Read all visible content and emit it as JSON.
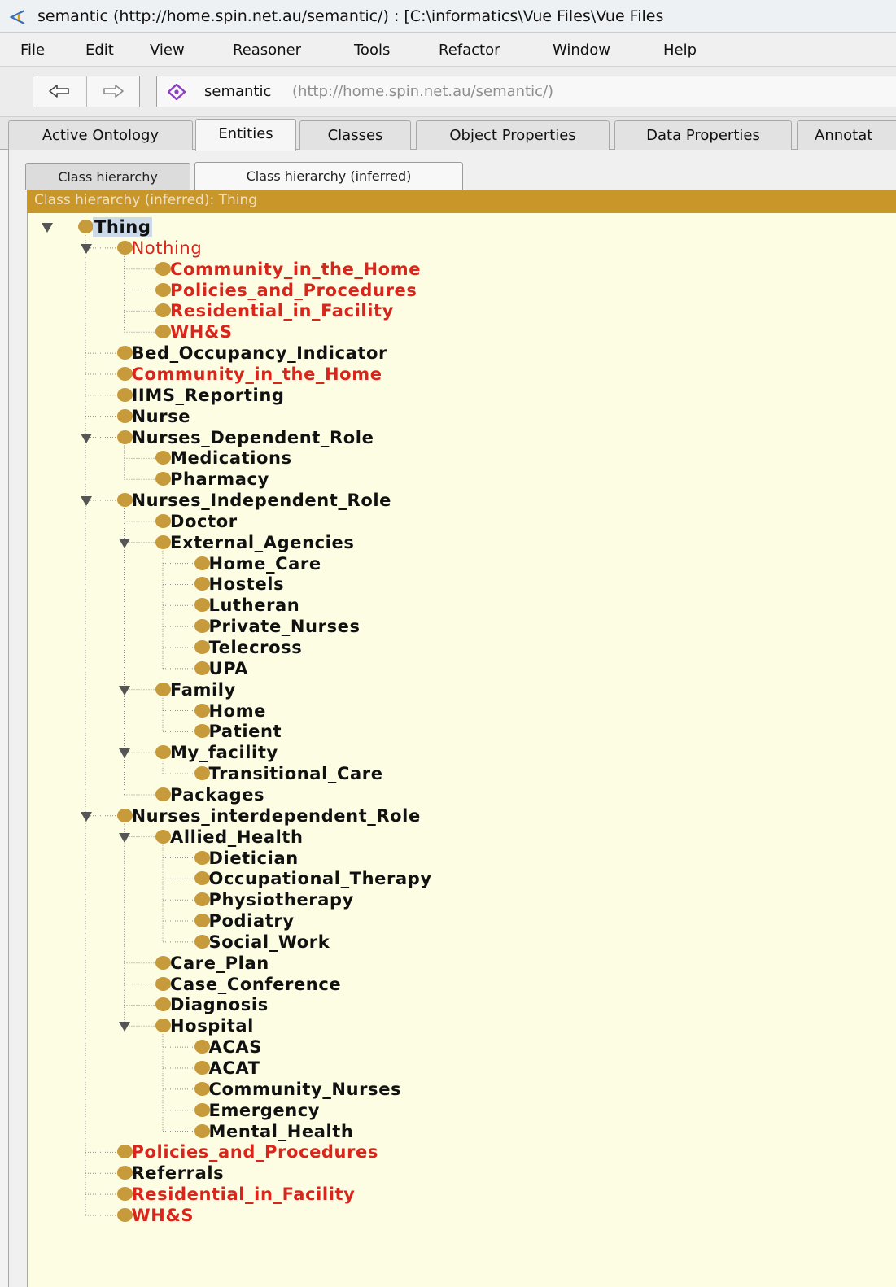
{
  "window": {
    "title": "semantic (http://home.spin.net.au/semantic/)  : [C:\\informatics\\Vue Files\\Vue Files"
  },
  "menu": [
    "File",
    "Edit",
    "View",
    "Reasoner",
    "Tools",
    "Refactor",
    "Window",
    "Help"
  ],
  "toolbar": {
    "ontology_name": "semantic",
    "ontology_iri": "(http://home.spin.net.au/semantic/)"
  },
  "tabs": [
    {
      "label": "Active Ontology",
      "active": false
    },
    {
      "label": "Entities",
      "active": true
    },
    {
      "label": "Classes",
      "active": false
    },
    {
      "label": "Object Properties",
      "active": false
    },
    {
      "label": "Data Properties",
      "active": false
    },
    {
      "label": "Annotat",
      "active": false
    }
  ],
  "subtabs": [
    {
      "label": "Class hierarchy",
      "active": false
    },
    {
      "label": "Class hierarchy (inferred)",
      "active": true
    }
  ],
  "view_header": "Class hierarchy (inferred): Thing",
  "colors": {
    "header_bar": "#c9962a",
    "tree_background": "#fdfde3",
    "class_bullet": "#c79a3c",
    "unsatisfiable_text": "#d8261c"
  },
  "tree": [
    {
      "label": "Thing",
      "depth": 0,
      "expanded": true,
      "selected": true
    },
    {
      "label": "Nothing",
      "depth": 1,
      "expanded": true,
      "red": true,
      "light": true
    },
    {
      "label": "Community_in_the_Home",
      "depth": 2,
      "red": true
    },
    {
      "label": "Policies_and_Procedures",
      "depth": 2,
      "red": true
    },
    {
      "label": "Residential_in_Facility",
      "depth": 2,
      "red": true
    },
    {
      "label": "WH&S",
      "depth": 2,
      "red": true
    },
    {
      "label": "Bed_Occupancy_Indicator",
      "depth": 1
    },
    {
      "label": "Community_in_the_Home",
      "depth": 1,
      "red": true
    },
    {
      "label": "IIMS_Reporting",
      "depth": 1
    },
    {
      "label": "Nurse",
      "depth": 1
    },
    {
      "label": "Nurses_Dependent_Role",
      "depth": 1,
      "expanded": true
    },
    {
      "label": "Medications",
      "depth": 2
    },
    {
      "label": "Pharmacy",
      "depth": 2
    },
    {
      "label": "Nurses_Independent_Role",
      "depth": 1,
      "expanded": true
    },
    {
      "label": "Doctor",
      "depth": 2
    },
    {
      "label": "External_Agencies",
      "depth": 2,
      "expanded": true
    },
    {
      "label": "Home_Care",
      "depth": 3
    },
    {
      "label": "Hostels",
      "depth": 3
    },
    {
      "label": "Lutheran",
      "depth": 3
    },
    {
      "label": "Private_Nurses",
      "depth": 3
    },
    {
      "label": "Telecross",
      "depth": 3
    },
    {
      "label": "UPA",
      "depth": 3
    },
    {
      "label": "Family",
      "depth": 2,
      "expanded": true
    },
    {
      "label": "Home",
      "depth": 3
    },
    {
      "label": "Patient",
      "depth": 3
    },
    {
      "label": "My_facility",
      "depth": 2,
      "expanded": true
    },
    {
      "label": "Transitional_Care",
      "depth": 3
    },
    {
      "label": "Packages",
      "depth": 2
    },
    {
      "label": "Nurses_interdependent_Role",
      "depth": 1,
      "expanded": true
    },
    {
      "label": "Allied_Health",
      "depth": 2,
      "expanded": true
    },
    {
      "label": "Dietician",
      "depth": 3
    },
    {
      "label": "Occupational_Therapy",
      "depth": 3
    },
    {
      "label": "Physiotherapy",
      "depth": 3
    },
    {
      "label": "Podiatry",
      "depth": 3
    },
    {
      "label": "Social_Work",
      "depth": 3
    },
    {
      "label": "Care_Plan",
      "depth": 2
    },
    {
      "label": "Case_Conference",
      "depth": 2
    },
    {
      "label": "Diagnosis",
      "depth": 2
    },
    {
      "label": "Hospital",
      "depth": 2,
      "expanded": true
    },
    {
      "label": "ACAS",
      "depth": 3
    },
    {
      "label": "ACAT",
      "depth": 3
    },
    {
      "label": "Community_Nurses",
      "depth": 3
    },
    {
      "label": "Emergency",
      "depth": 3
    },
    {
      "label": "Mental_Health",
      "depth": 3
    },
    {
      "label": "Policies_and_Procedures",
      "depth": 1,
      "red": true
    },
    {
      "label": "Referrals",
      "depth": 1
    },
    {
      "label": "Residential_in_Facility",
      "depth": 1,
      "red": true
    },
    {
      "label": "WH&S",
      "depth": 1,
      "red": true
    }
  ]
}
